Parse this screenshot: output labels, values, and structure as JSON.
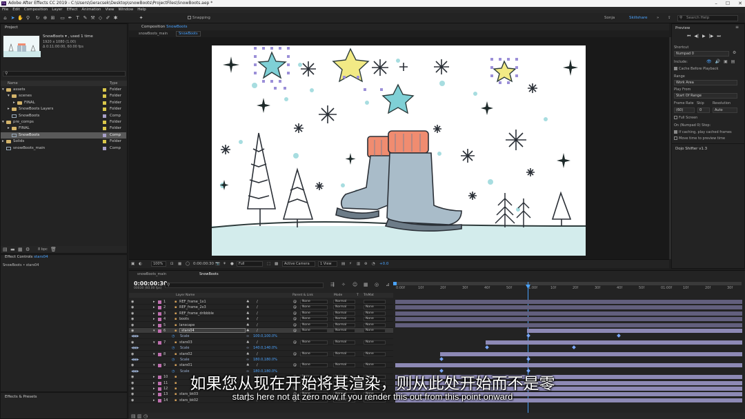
{
  "window": {
    "title": "Adobe After Effects CC 2019 - C:\\Users\\Geracsek\\Desktop\\snowBoots\\ProjectFiles\\SnowBoots.aep *",
    "logo": "Ae"
  },
  "menu": [
    "File",
    "Edit",
    "Composition",
    "Layer",
    "Effect",
    "Animation",
    "View",
    "Window",
    "Help"
  ],
  "toolbar": {
    "snapping": "Snapping",
    "user": "Sonja",
    "workspace": "Skillshare",
    "search_placeholder": "Search Help"
  },
  "project": {
    "tab": "Project",
    "thumb_name": "SnowBoots ▾ , used 1 time",
    "thumb_info1": "1920 x 1080 (1.00)",
    "thumb_info2": "Δ 0:11:00:00, 60.00 fps",
    "search_placeholder": "",
    "col_name": "Name",
    "col_type": "Type",
    "items": [
      {
        "name": "assets",
        "type": "Folder",
        "kind": "folder",
        "color": "#d9c64a"
      },
      {
        "name": "scenes",
        "type": "Folder",
        "kind": "folder",
        "color": "#d9c64a"
      },
      {
        "name": "FINAL",
        "type": "Folder",
        "kind": "folder",
        "color": "#d9c64a"
      },
      {
        "name": "SnowBoots Layers",
        "type": "Folder",
        "kind": "folder",
        "color": "#d9c64a"
      },
      {
        "name": "SnowBoots",
        "type": "Comp",
        "kind": "comp",
        "color": "#a79fc8"
      },
      {
        "name": "pre_comps",
        "type": "Folder",
        "kind": "folder",
        "color": "#d9c64a"
      },
      {
        "name": "FINAL",
        "type": "Folder",
        "kind": "folder",
        "color": "#d9c64a"
      },
      {
        "name": "SnowBoots",
        "type": "Comp",
        "kind": "comp",
        "color": "#a79fc8"
      },
      {
        "name": "Solids",
        "type": "Folder",
        "kind": "folder",
        "color": "#d9c64a"
      },
      {
        "name": "snowBoots_main",
        "type": "Comp",
        "kind": "comp",
        "color": "#a79fc8"
      }
    ],
    "bpc": "8 bpc"
  },
  "effect_controls": {
    "tab": "Effect Controls",
    "tab_layer": "stars04",
    "subtitle": "SnowBoots • stars04"
  },
  "effects_presets": {
    "tab": "Effects & Presets"
  },
  "composition": {
    "tab_prefix": "Composition",
    "tab_name": "SnowBoots",
    "breadcrumbs": [
      "snowBoots_main",
      "SnowBoots"
    ]
  },
  "viewer_bar": {
    "zoom": "100%",
    "timecode": "0:00:00:30",
    "resolution": "Full",
    "camera": "Active Camera",
    "views": "1 View",
    "exposure": "+0.0"
  },
  "preview": {
    "tab": "Preview",
    "shortcut_label": "Shortcut",
    "shortcut_value": "Numpad 0",
    "include_label": "Include:",
    "cache": "Cache Before Playback",
    "range_label": "Range",
    "range_value": "Work Area",
    "play_from_label": "Play From",
    "play_from_value": "Start Of Range",
    "frame_rate_label": "Frame Rate",
    "skip_label": "Skip",
    "resolution_label": "Resolution",
    "frame_rate_value": "(60)",
    "skip_value": "0",
    "resolution_value": "Auto",
    "full_screen": "Full Screen",
    "stop_label": "On (Numpad 0) Stop:",
    "if_caching": "If caching, play cached frames",
    "move_time": "Move time to preview time",
    "plugin": "Dojo Shifter v1.3"
  },
  "timeline": {
    "tabs": [
      "snowBoots_main",
      "SnowBoots"
    ],
    "timecode": "0:00:00:30",
    "timecode_sub": "00030 (60.00 fps)",
    "col_layer_name": "Layer Name",
    "col_parent": "Parent & Link",
    "col_mode": "Mode",
    "col_t": "T",
    "col_trkmat": "TrkMat",
    "ruler": [
      "0:00f",
      "10f",
      "20f",
      "30f",
      "40f",
      "50f",
      "1:00f",
      "10f",
      "20f",
      "30f",
      "40f",
      "50f",
      "01:00f",
      "10f",
      "20f",
      "30f"
    ],
    "rows": [
      {
        "num": "1",
        "name": "REF_frame_1x1",
        "color": "#c06fb0",
        "parent": "None",
        "mode": "Normal",
        "trk": "",
        "type": "layer"
      },
      {
        "num": "2",
        "name": "REF_frame_2x3",
        "color": "#c06fb0",
        "parent": "None",
        "mode": "Normal",
        "trk": "None",
        "type": "layer"
      },
      {
        "num": "3",
        "name": "REF_frame_dribbble",
        "color": "#c06fb0",
        "parent": "None",
        "mode": "Normal",
        "trk": "None",
        "type": "layer"
      },
      {
        "num": "4",
        "name": "boots",
        "color": "#c06fb0",
        "parent": "None",
        "mode": "Normal",
        "trk": "None",
        "type": "layer"
      },
      {
        "num": "5",
        "name": "lanscape",
        "color": "#c06fb0",
        "parent": "None",
        "mode": "Normal",
        "trk": "None",
        "type": "layer"
      },
      {
        "num": "6",
        "name": "stars04",
        "color": "#c06fb0",
        "parent": "None",
        "mode": "Normal",
        "trk": "None",
        "type": "layer",
        "sel": true
      },
      {
        "num": "",
        "name": "Scale",
        "value": "100.0,100.0%",
        "type": "prop"
      },
      {
        "num": "7",
        "name": "stars03",
        "color": "#c06fb0",
        "parent": "None",
        "mode": "Normal",
        "trk": "None",
        "type": "layer"
      },
      {
        "num": "",
        "name": "Scale",
        "value": "140.0,140.0%",
        "type": "prop"
      },
      {
        "num": "8",
        "name": "stars02",
        "color": "#c06fb0",
        "parent": "None",
        "mode": "Normal",
        "trk": "None",
        "type": "layer"
      },
      {
        "num": "",
        "name": "Scale",
        "value": "180.0,180.0%",
        "type": "prop"
      },
      {
        "num": "9",
        "name": "stars01",
        "color": "#c06fb0",
        "parent": "None",
        "mode": "Normal",
        "trk": "None",
        "type": "layer"
      },
      {
        "num": "",
        "name": "Scale",
        "value": "180.0,180.0%",
        "type": "prop"
      },
      {
        "num": "10",
        "name": "",
        "color": "#c06fb0",
        "parent": "None",
        "mode": "Normal",
        "trk": "None",
        "type": "layer"
      },
      {
        "num": "11",
        "name": "",
        "color": "#c06fb0",
        "parent": "None",
        "mode": "Normal",
        "trk": "None",
        "type": "layer"
      },
      {
        "num": "12",
        "name": "",
        "color": "#c06fb0",
        "parent": "None",
        "mode": "Normal",
        "trk": "None",
        "type": "layer"
      },
      {
        "num": "13",
        "name": "stars_bk03",
        "color": "#c06fb0",
        "parent": "None",
        "mode": "Normal",
        "trk": "None",
        "type": "layer"
      },
      {
        "num": "14",
        "name": "stars_bk02",
        "color": "#c06fb0",
        "parent": "None",
        "mode": "Normal",
        "trk": "None",
        "type": "layer"
      }
    ]
  },
  "subtitles": {
    "cn": "如果您从现在开始将其渲染，则从此处开始而不是零",
    "en": "starts here not at zero now if you render this out from this point onward"
  },
  "colors": {
    "accent": "#4aa3ff",
    "star_blue": "#7fd0d6",
    "star_yellow": "#f2ea85",
    "boots": "#a9bcc9",
    "socks": "#f08c70"
  }
}
